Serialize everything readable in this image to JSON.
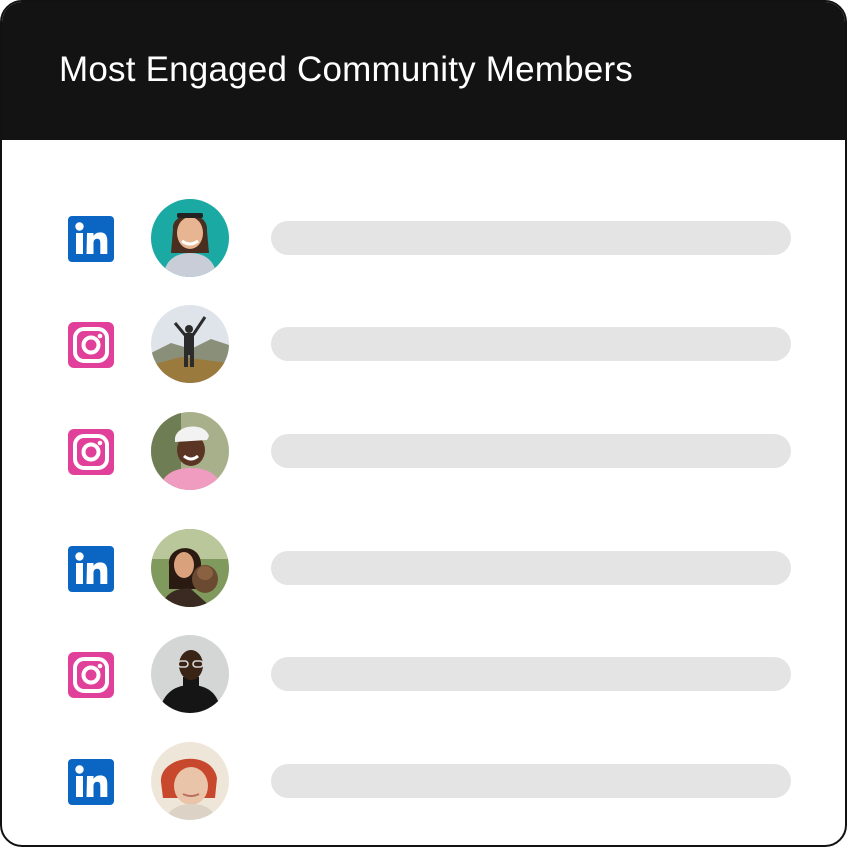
{
  "header": {
    "title": "Most Engaged Community Members"
  },
  "members": [
    {
      "network": "linkedin",
      "icon": "linkedin-icon",
      "avatar": "avatar-woman-teal-background"
    },
    {
      "network": "instagram",
      "icon": "instagram-icon",
      "avatar": "avatar-hiker-on-mountain"
    },
    {
      "network": "instagram",
      "icon": "instagram-icon",
      "avatar": "avatar-woman-white-cap"
    },
    {
      "network": "linkedin",
      "icon": "linkedin-icon",
      "avatar": "avatar-woman-with-dog"
    },
    {
      "network": "instagram",
      "icon": "instagram-icon",
      "avatar": "avatar-man-turtleneck-glasses"
    },
    {
      "network": "linkedin",
      "icon": "linkedin-icon",
      "avatar": "avatar-woman-red-hair"
    }
  ],
  "colors": {
    "header_bg": "#131313",
    "linkedin_blue": "#0A66C2",
    "instagram_pink": "#E1409A",
    "placeholder_bar": "#E4E4E4",
    "border": "#111111"
  }
}
